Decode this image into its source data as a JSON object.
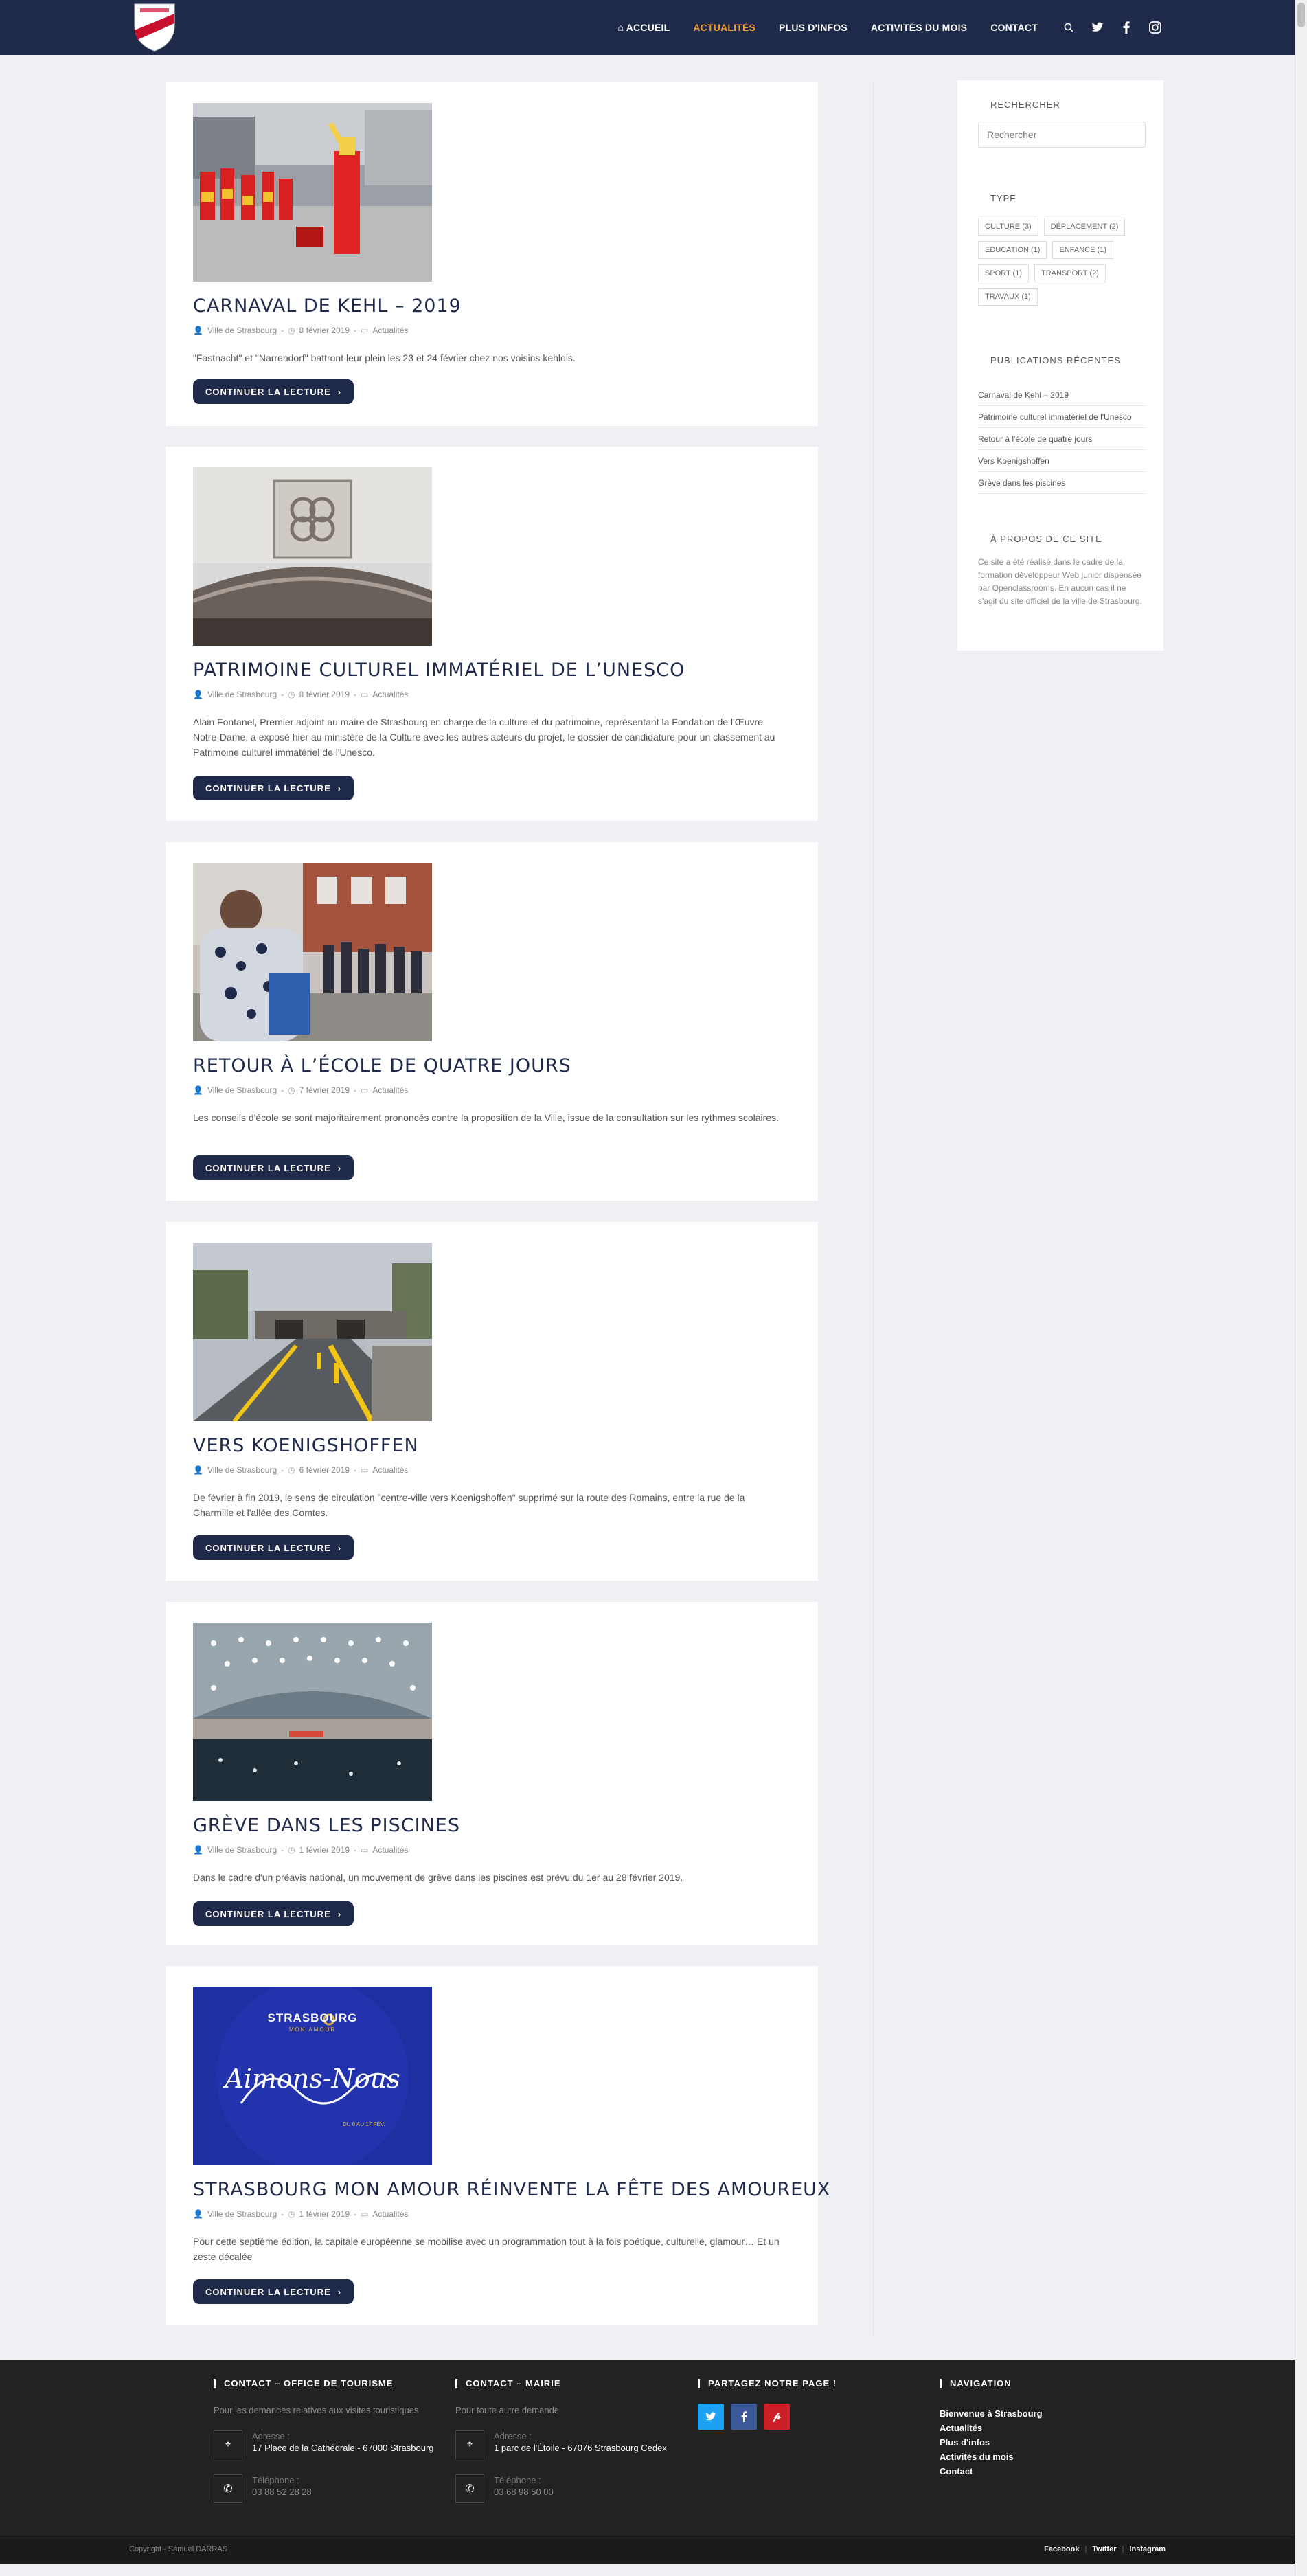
{
  "header": {
    "nav": [
      {
        "label": "Accueil",
        "icon": "home-icon"
      },
      {
        "label": "Actualités",
        "active": true
      },
      {
        "label": "Plus d'infos"
      },
      {
        "label": "Activités du mois"
      },
      {
        "label": "Contact"
      }
    ],
    "icons": [
      "search-icon",
      "twitter-icon",
      "facebook-icon",
      "instagram-icon"
    ],
    "accent_color": "#f0a02a",
    "bar_color": "#1f2a4a"
  },
  "articles": [
    {
      "title": "Carnaval de Kehl – 2019",
      "author": "Ville de Strasbourg",
      "date": "8 février 2019",
      "category": "Actualités",
      "excerpt": "\"Fastnacht\" et \"Narrendorf\" battront leur plein les 23 et 24 février chez nos voisins kehlois.",
      "button": "Continuer la lecture"
    },
    {
      "title": "Patrimoine culturel immatériel de l’Unesco",
      "author": "Ville de Strasbourg",
      "date": "8 février 2019",
      "category": "Actualités",
      "excerpt": "Alain Fontanel, Premier adjoint au maire de Strasbourg en charge de la culture et du patrimoine, représentant la Fondation de l'Œuvre Notre-Dame, a exposé hier au ministère de la Culture avec les autres acteurs du projet, le dossier de candidature pour un classement au Patrimoine culturel immatériel de l'Unesco.",
      "button": "Continuer la lecture"
    },
    {
      "title": "Retour à l’école de quatre jours",
      "author": "Ville de Strasbourg",
      "date": "7 février 2019",
      "category": "Actualités",
      "excerpt": "Les conseils d'école se sont majoritairement prononcés contre la proposition de la Ville, issue de la consultation sur les rythmes scolaires.",
      "button": "Continuer la lecture"
    },
    {
      "title": "Vers Koenigshoffen",
      "author": "Ville de Strasbourg",
      "date": "6 février 2019",
      "category": "Actualités",
      "excerpt": "De février à fin 2019, le sens de circulation \"centre-ville vers Koenigshoffen\" supprimé sur la route des Romains, entre la rue de la Charmille et l'allée des Comtes.",
      "button": "Continuer la lecture"
    },
    {
      "title": "Grève dans les piscines",
      "author": "Ville de Strasbourg",
      "date": "1 février 2019",
      "category": "Actualités",
      "excerpt": "Dans le cadre d'un préavis national, un mouvement de grève dans les piscines est prévu du 1er au 28 février 2019.",
      "button": "Continuer la lecture"
    },
    {
      "title": "Strasbourg mon amour réinvente la fête des amoureux",
      "author": "Ville de Strasbourg",
      "date": "1 février 2019",
      "category": "Actualités",
      "excerpt": "Pour cette septième édition, la capitale européenne se mobilise avec un programmation tout à la fois poétique, culturelle, glamour… Et un zeste décalée",
      "button": "Continuer la lecture",
      "image_text": {
        "brand": "STRASBOURG",
        "tagline": "MON AMOUR",
        "script": "Aimons-Nous",
        "dates": "DU 8 AU 17 FÉV."
      }
    }
  ],
  "sidebar": {
    "search_title": "Rechercher",
    "search_placeholder": "Rechercher",
    "type_title": "Type",
    "tags": [
      "Culture (3)",
      "Déplacement (2)",
      "Education (1)",
      "Enfance (1)",
      "Sport (1)",
      "Transport (2)",
      "Travaux (1)"
    ],
    "recent_title": "Publications récentes",
    "recent": [
      "Carnaval de Kehl – 2019",
      "Patrimoine culturel immatériel de l'Unesco",
      "Retour à l'école de quatre jours",
      "Vers Koenigshoffen",
      "Grève dans les piscines"
    ],
    "about_title": "À propos de ce site",
    "about_text": "Ce site a été réalisé dans le cadre de la formation développeur Web junior dispensée par Openclassrooms. En aucun cas il ne s'agit du site officiel de la ville de Strasbourg."
  },
  "footer": {
    "col1": {
      "title": "Contact – Office de tourisme",
      "text": "Pour les demandes relatives aux visites touristiques",
      "address_label": "Adresse :",
      "address": "17 Place de la Cathédrale - 67000 Strasbourg",
      "phone_label": "Téléphone :",
      "phone": "03 88 52 28 28"
    },
    "col2": {
      "title": "Contact – Mairie",
      "text": "Pour toute autre demande",
      "address_label": "Adresse :",
      "address": "1 parc de l'Étoile - 67076 Strasbourg Cedex",
      "phone_label": "Téléphone :",
      "phone": "03 68 98 50 00"
    },
    "col3": {
      "title": "Partagez notre page !",
      "buttons": [
        {
          "icon": "twitter-icon",
          "color": "#1da1f2"
        },
        {
          "icon": "facebook-icon",
          "color": "#3b5998"
        },
        {
          "icon": "pinterest-icon",
          "color": "#cb2027"
        }
      ]
    },
    "col4": {
      "title": "Navigation",
      "items": [
        "Bienvenue à Strasbourg",
        "Actualités",
        "Plus d'infos",
        "Activités du mois",
        "Contact"
      ]
    },
    "copyright": "Copyright - Samuel DARRAS",
    "social_links": [
      "Facebook",
      "Twitter",
      "Instagram"
    ]
  }
}
